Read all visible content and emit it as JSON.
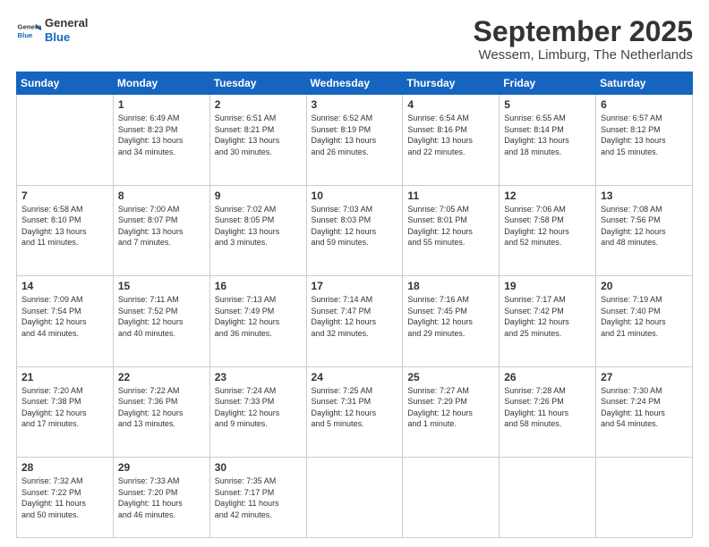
{
  "header": {
    "logo_general": "General",
    "logo_blue": "Blue",
    "month": "September 2025",
    "location": "Wessem, Limburg, The Netherlands"
  },
  "weekdays": [
    "Sunday",
    "Monday",
    "Tuesday",
    "Wednesday",
    "Thursday",
    "Friday",
    "Saturday"
  ],
  "weeks": [
    [
      {
        "day": "",
        "info": ""
      },
      {
        "day": "1",
        "info": "Sunrise: 6:49 AM\nSunset: 8:23 PM\nDaylight: 13 hours\nand 34 minutes."
      },
      {
        "day": "2",
        "info": "Sunrise: 6:51 AM\nSunset: 8:21 PM\nDaylight: 13 hours\nand 30 minutes."
      },
      {
        "day": "3",
        "info": "Sunrise: 6:52 AM\nSunset: 8:19 PM\nDaylight: 13 hours\nand 26 minutes."
      },
      {
        "day": "4",
        "info": "Sunrise: 6:54 AM\nSunset: 8:16 PM\nDaylight: 13 hours\nand 22 minutes."
      },
      {
        "day": "5",
        "info": "Sunrise: 6:55 AM\nSunset: 8:14 PM\nDaylight: 13 hours\nand 18 minutes."
      },
      {
        "day": "6",
        "info": "Sunrise: 6:57 AM\nSunset: 8:12 PM\nDaylight: 13 hours\nand 15 minutes."
      }
    ],
    [
      {
        "day": "7",
        "info": "Sunrise: 6:58 AM\nSunset: 8:10 PM\nDaylight: 13 hours\nand 11 minutes."
      },
      {
        "day": "8",
        "info": "Sunrise: 7:00 AM\nSunset: 8:07 PM\nDaylight: 13 hours\nand 7 minutes."
      },
      {
        "day": "9",
        "info": "Sunrise: 7:02 AM\nSunset: 8:05 PM\nDaylight: 13 hours\nand 3 minutes."
      },
      {
        "day": "10",
        "info": "Sunrise: 7:03 AM\nSunset: 8:03 PM\nDaylight: 12 hours\nand 59 minutes."
      },
      {
        "day": "11",
        "info": "Sunrise: 7:05 AM\nSunset: 8:01 PM\nDaylight: 12 hours\nand 55 minutes."
      },
      {
        "day": "12",
        "info": "Sunrise: 7:06 AM\nSunset: 7:58 PM\nDaylight: 12 hours\nand 52 minutes."
      },
      {
        "day": "13",
        "info": "Sunrise: 7:08 AM\nSunset: 7:56 PM\nDaylight: 12 hours\nand 48 minutes."
      }
    ],
    [
      {
        "day": "14",
        "info": "Sunrise: 7:09 AM\nSunset: 7:54 PM\nDaylight: 12 hours\nand 44 minutes."
      },
      {
        "day": "15",
        "info": "Sunrise: 7:11 AM\nSunset: 7:52 PM\nDaylight: 12 hours\nand 40 minutes."
      },
      {
        "day": "16",
        "info": "Sunrise: 7:13 AM\nSunset: 7:49 PM\nDaylight: 12 hours\nand 36 minutes."
      },
      {
        "day": "17",
        "info": "Sunrise: 7:14 AM\nSunset: 7:47 PM\nDaylight: 12 hours\nand 32 minutes."
      },
      {
        "day": "18",
        "info": "Sunrise: 7:16 AM\nSunset: 7:45 PM\nDaylight: 12 hours\nand 29 minutes."
      },
      {
        "day": "19",
        "info": "Sunrise: 7:17 AM\nSunset: 7:42 PM\nDaylight: 12 hours\nand 25 minutes."
      },
      {
        "day": "20",
        "info": "Sunrise: 7:19 AM\nSunset: 7:40 PM\nDaylight: 12 hours\nand 21 minutes."
      }
    ],
    [
      {
        "day": "21",
        "info": "Sunrise: 7:20 AM\nSunset: 7:38 PM\nDaylight: 12 hours\nand 17 minutes."
      },
      {
        "day": "22",
        "info": "Sunrise: 7:22 AM\nSunset: 7:36 PM\nDaylight: 12 hours\nand 13 minutes."
      },
      {
        "day": "23",
        "info": "Sunrise: 7:24 AM\nSunset: 7:33 PM\nDaylight: 12 hours\nand 9 minutes."
      },
      {
        "day": "24",
        "info": "Sunrise: 7:25 AM\nSunset: 7:31 PM\nDaylight: 12 hours\nand 5 minutes."
      },
      {
        "day": "25",
        "info": "Sunrise: 7:27 AM\nSunset: 7:29 PM\nDaylight: 12 hours\nand 1 minute."
      },
      {
        "day": "26",
        "info": "Sunrise: 7:28 AM\nSunset: 7:26 PM\nDaylight: 11 hours\nand 58 minutes."
      },
      {
        "day": "27",
        "info": "Sunrise: 7:30 AM\nSunset: 7:24 PM\nDaylight: 11 hours\nand 54 minutes."
      }
    ],
    [
      {
        "day": "28",
        "info": "Sunrise: 7:32 AM\nSunset: 7:22 PM\nDaylight: 11 hours\nand 50 minutes."
      },
      {
        "day": "29",
        "info": "Sunrise: 7:33 AM\nSunset: 7:20 PM\nDaylight: 11 hours\nand 46 minutes."
      },
      {
        "day": "30",
        "info": "Sunrise: 7:35 AM\nSunset: 7:17 PM\nDaylight: 11 hours\nand 42 minutes."
      },
      {
        "day": "",
        "info": ""
      },
      {
        "day": "",
        "info": ""
      },
      {
        "day": "",
        "info": ""
      },
      {
        "day": "",
        "info": ""
      }
    ]
  ]
}
